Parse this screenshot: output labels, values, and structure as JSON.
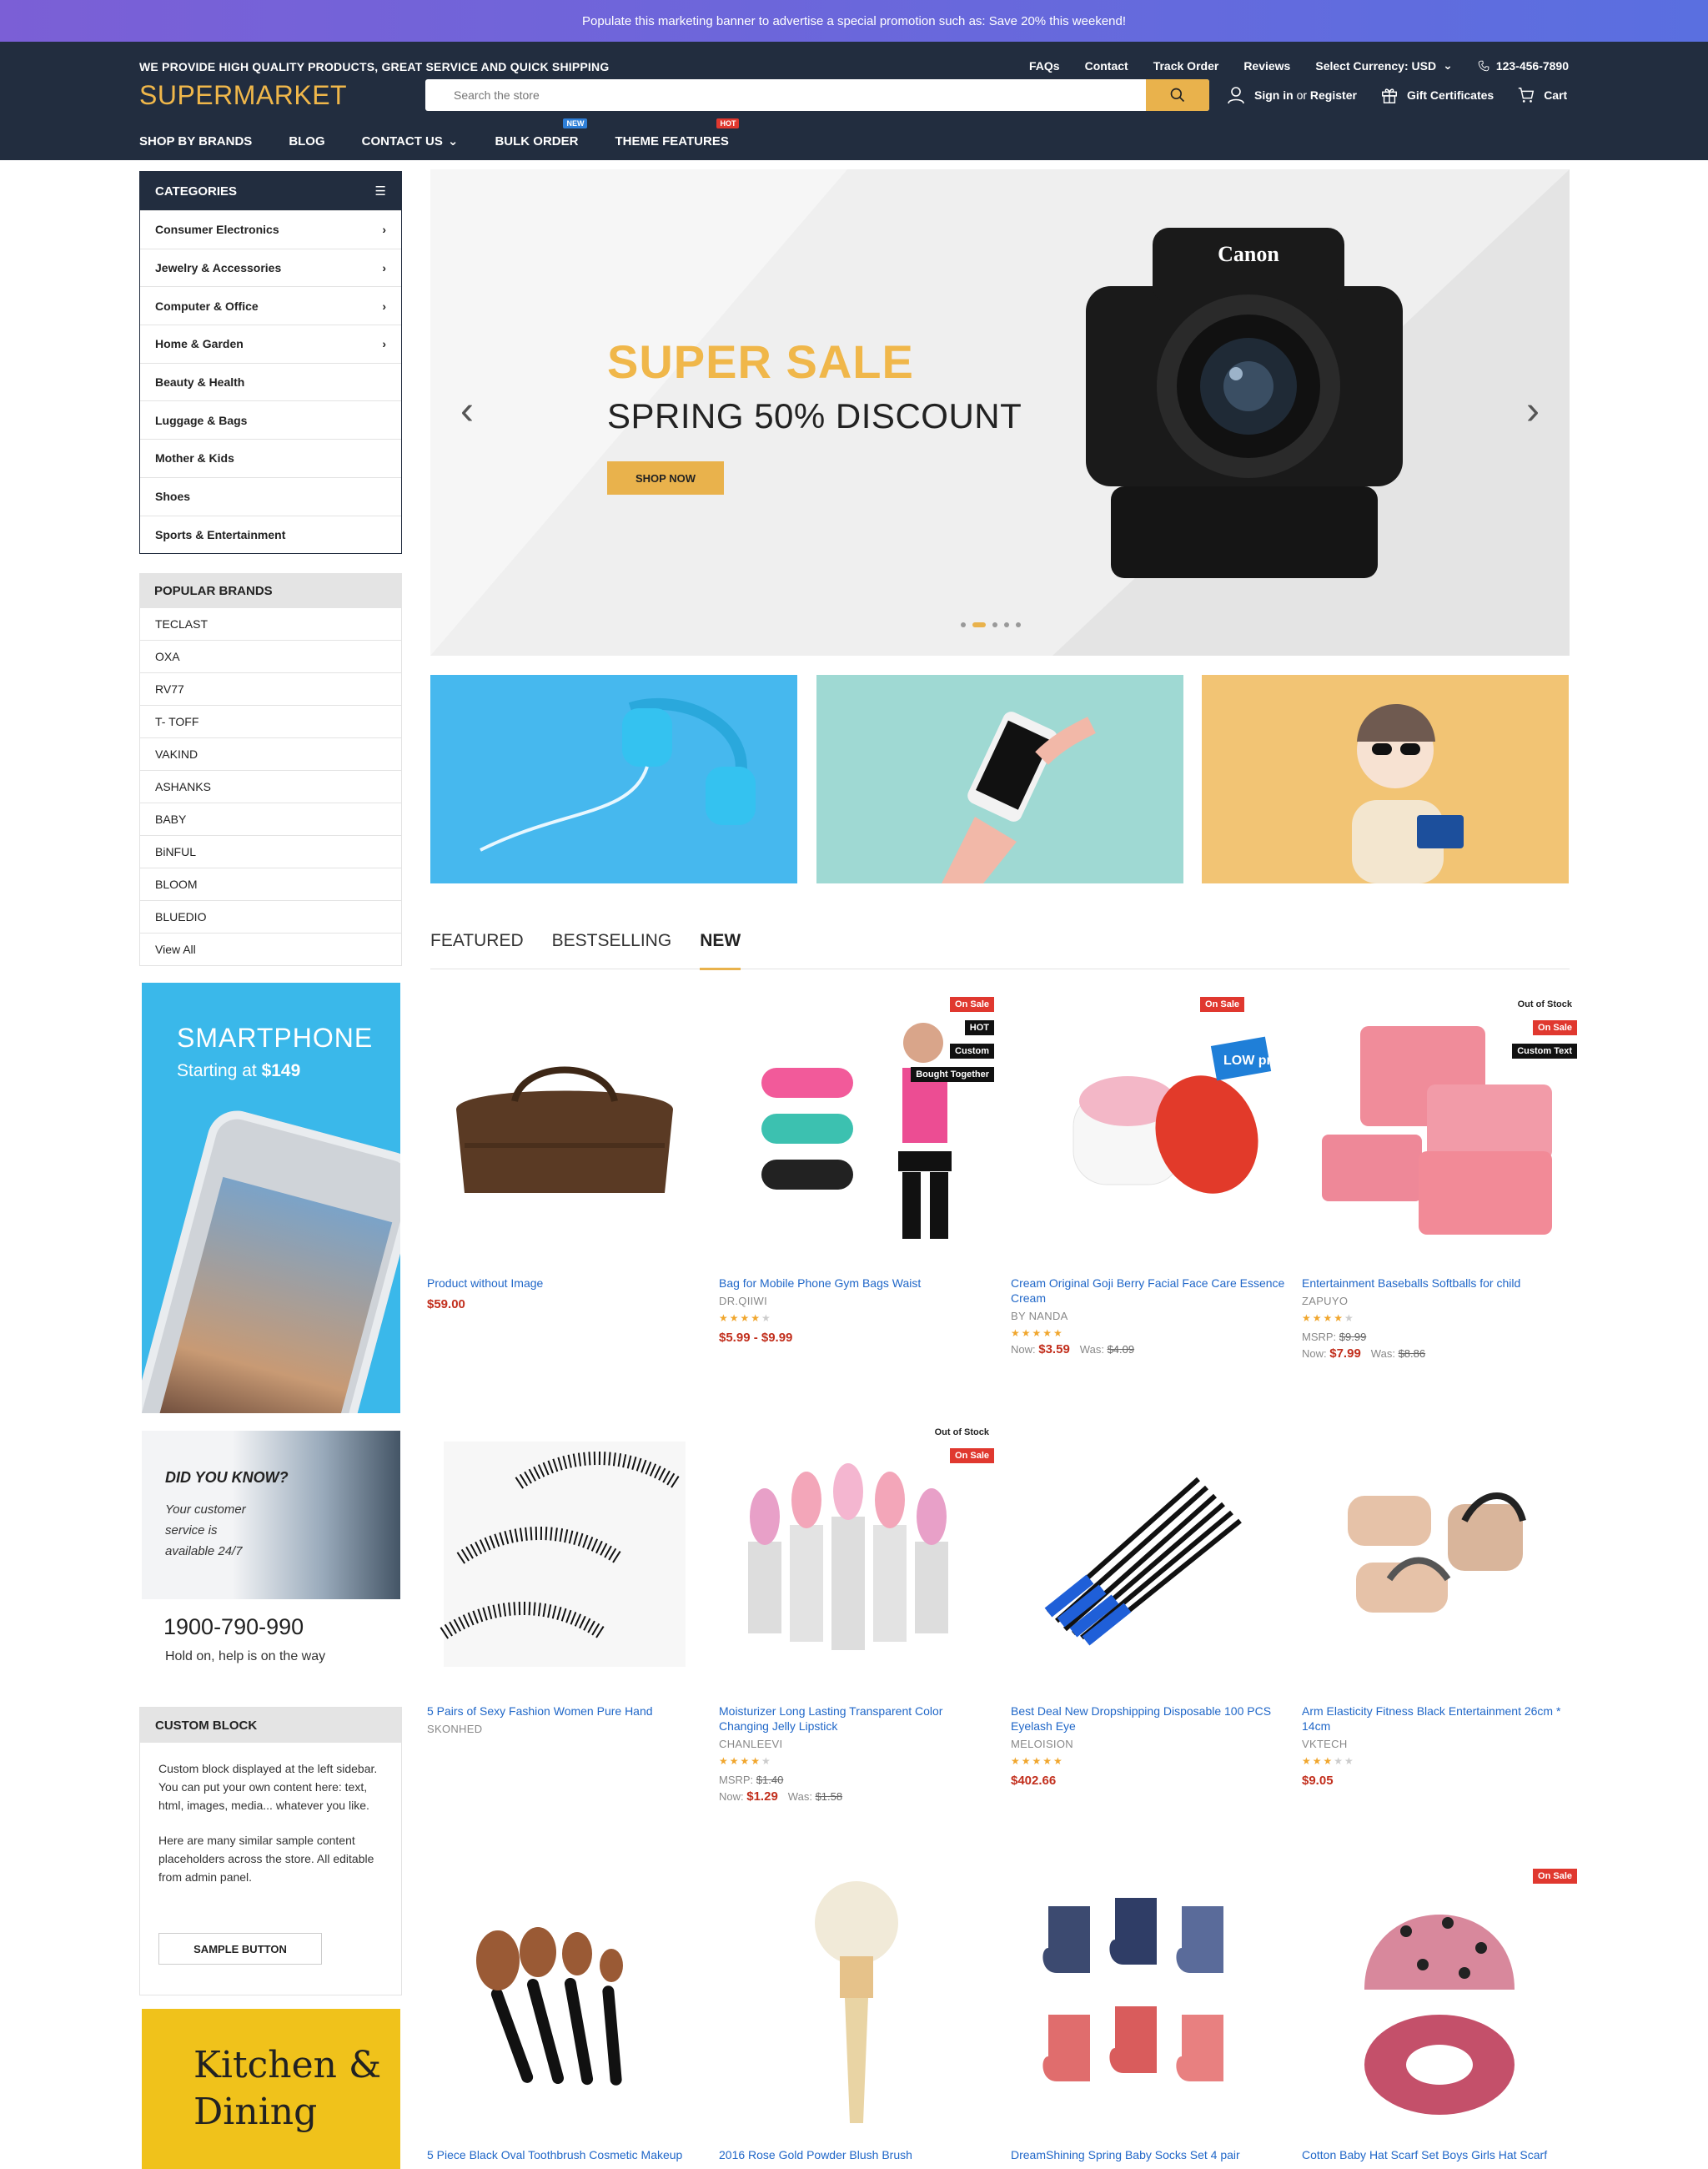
{
  "promo": "Populate this marketing banner to advertise a special promotion such as: Save 20% this weekend!",
  "header": {
    "tagline": "WE PROVIDE HIGH QUALITY PRODUCTS, GREAT SERVICE AND QUICK SHIPPING",
    "links": [
      "FAQs",
      "Contact",
      "Track Order",
      "Reviews"
    ],
    "currency": "Select Currency: USD",
    "phone": "123-456-7890",
    "logo": "SUPERMARKET",
    "search_placeholder": "Search the store",
    "sign_in": "Sign in",
    "or": "or",
    "register": "Register",
    "gift": "Gift Certificates",
    "cart": "Cart"
  },
  "nav": {
    "items": [
      "SHOP BY BRANDS",
      "BLOG",
      "CONTACT US",
      "BULK ORDER",
      "THEME FEATURES"
    ],
    "badge_new": "NEW",
    "badge_hot": "HOT"
  },
  "categories": {
    "title": "CATEGORIES",
    "items": [
      "Consumer Electronics",
      "Jewelry & Accessories",
      "Computer & Office",
      "Home & Garden",
      "Beauty & Health",
      "Luggage & Bags",
      "Mother & Kids",
      "Shoes",
      "Sports & Entertainment"
    ]
  },
  "brands": {
    "title": "POPULAR BRANDS",
    "items": [
      "TECLAST",
      "OXA",
      "RV77",
      "T- TOFF",
      "VAKIND",
      "ASHANKS",
      "BABY",
      "BiNFUL",
      "BLOOM",
      "BLUEDIO",
      "View All"
    ]
  },
  "ad_phone": {
    "title": "SMARTPHONE",
    "sub": "Starting at",
    "price": "$149"
  },
  "ad_know": {
    "q": "DID YOU KNOW?",
    "s": "Your customer service is available 24/7",
    "phone": "1900-790-990",
    "help": "Hold on, help is on the way"
  },
  "custom_block": {
    "title": "CUSTOM BLOCK",
    "p1": "Custom block displayed at the left sidebar. You can put your own content here: text, html, images, media... whatever you like.",
    "p2": "Here are many similar sample content placeholders across the store. All editable from admin panel.",
    "button": "SAMPLE BUTTON"
  },
  "kitchen": {
    "line1": "Kitchen &",
    "line2": "Dining"
  },
  "hero": {
    "title": "SUPER SALE",
    "subtitle": "SPRING 50% DISCOUNT",
    "button": "SHOP NOW",
    "camera_brand": "Canon"
  },
  "tabs": [
    "FEATURED",
    "BESTSELLING",
    "NEW"
  ],
  "products": [
    {
      "name": "Product without Image",
      "brand": "",
      "price": "$59.00"
    },
    {
      "name": "Bag for Mobile Phone Gym Bags Waist",
      "brand": "DR.QIIWI",
      "price": "$5.99 - $9.99",
      "tags": [
        "On Sale",
        "HOT",
        "Custom",
        "Bought Together"
      ]
    },
    {
      "name": "Cream Original Goji Berry Facial Face Care Essence Cream",
      "brand": "BY NANDA",
      "now": "$3.59",
      "was": "$4.09",
      "tags": [
        "On Sale"
      ],
      "low_price": "LOW price"
    },
    {
      "name": "Entertainment Baseballs Softballs for child",
      "brand": "ZAPUYO",
      "msrp": "$9.99",
      "now": "$7.99",
      "was": "$8.86",
      "tags": [
        "Out of Stock",
        "On Sale",
        "Custom Text"
      ]
    },
    {
      "name": "5 Pairs of Sexy Fashion Women Pure Hand",
      "brand": "SKONHED"
    },
    {
      "name": "Moisturizer Long Lasting Transparent Color Changing Jelly Lipstick",
      "brand": "CHANLEEVI",
      "msrp": "$1.40",
      "now": "$1.29",
      "was": "$1.58",
      "tags": [
        "Out of Stock",
        "On Sale"
      ]
    },
    {
      "name": "Best Deal New Dropshipping Disposable 100 PCS Eyelash Eye",
      "brand": "MELOISION",
      "price": "$402.66"
    },
    {
      "name": "Arm Elasticity Fitness Black Entertainment 26cm * 14cm",
      "brand": "VKTECH",
      "price": "$9.05"
    },
    {
      "name": "5 Piece Black Oval Toothbrush Cosmetic Makeup"
    },
    {
      "name": "2016 Rose Gold Powder Blush Brush"
    },
    {
      "name": "DreamShining Spring Baby Socks Set 4 pair"
    },
    {
      "name": "Cotton Baby Hat Scarf Set Boys Girls Hat Scarf",
      "tags": [
        "On Sale"
      ]
    }
  ],
  "labels": {
    "msrp": "MSRP:",
    "now": "Now:",
    "was": "Was:"
  },
  "stars": {
    "p1": 4,
    "p2": 5,
    "p3": 4,
    "p5": 4,
    "p6": 5,
    "p7": 3
  }
}
